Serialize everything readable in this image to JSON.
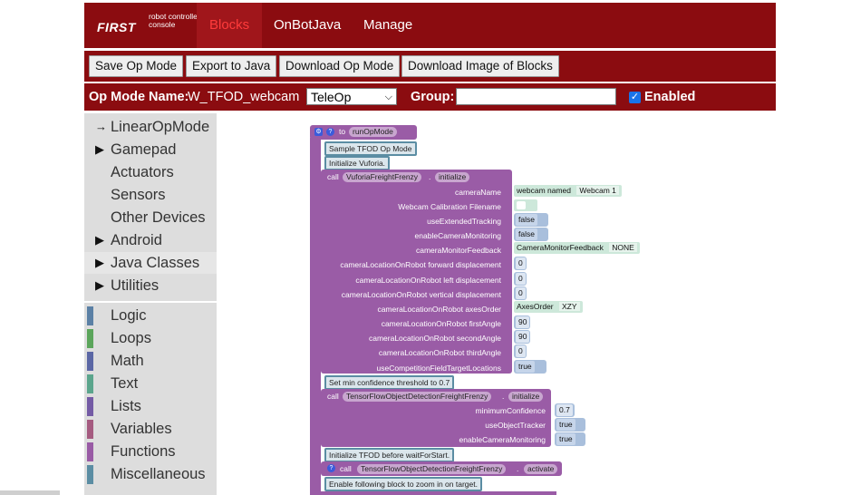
{
  "logo": {
    "first": "FIRST",
    "sub": "robot controller console"
  },
  "nav": {
    "tabs": [
      {
        "label": "Blocks",
        "active": true
      },
      {
        "label": "OnBotJava",
        "active": false
      },
      {
        "label": "Manage",
        "active": false
      }
    ]
  },
  "toolbar": {
    "save": "Save Op Mode",
    "export": "Export to Java",
    "download": "Download Op Mode",
    "download_image": "Download Image of Blocks"
  },
  "opmode": {
    "label": "Op Mode Name:",
    "name": "W_TFOD_webcam",
    "type": "TeleOp",
    "group_label": "Group:",
    "group_value": "",
    "enabled_label": "Enabled",
    "enabled": true
  },
  "sidebar": {
    "categories": [
      {
        "label": "LinearOpMode",
        "arrow": "→"
      },
      {
        "label": "Gamepad",
        "arrow": "▶"
      },
      {
        "label": "Actuators",
        "arrow": ""
      },
      {
        "label": "Sensors",
        "arrow": ""
      },
      {
        "label": "Other Devices",
        "arrow": ""
      },
      {
        "label": "Android",
        "arrow": "▶"
      },
      {
        "label": "Java Classes",
        "arrow": "▶"
      },
      {
        "label": "Utilities",
        "arrow": "▶"
      }
    ],
    "builtins": [
      {
        "label": "Logic",
        "color": "#5b80a5"
      },
      {
        "label": "Loops",
        "color": "#5ba55b"
      },
      {
        "label": "Math",
        "color": "#5b67a5"
      },
      {
        "label": "Text",
        "color": "#5ba58c"
      },
      {
        "label": "Lists",
        "color": "#745ba5"
      },
      {
        "label": "Variables",
        "color": "#a55b80"
      },
      {
        "label": "Functions",
        "color": "#995ba5"
      },
      {
        "label": "Miscellaneous",
        "color": "#5b8da3"
      }
    ]
  },
  "blocks": {
    "to": "to",
    "func_name": "runOpMode",
    "comment1": "Sample TFOD Op Mode",
    "comment2": "Initialize Vuforia.",
    "call": "call",
    "vuforia_class": "VuforiaFreightFrenzy",
    "dot": ".",
    "init": "initialize",
    "params": [
      {
        "label": "cameraName",
        "value": "webcam named",
        "value2": "Webcam 1"
      },
      {
        "label": "Webcam Calibration Filename",
        "value": "",
        "value2": ""
      },
      {
        "label": "useExtendedTracking",
        "value": "false",
        "value2": ""
      },
      {
        "label": "enableCameraMonitoring",
        "value": "false",
        "value2": ""
      },
      {
        "label": "cameraMonitorFeedback",
        "value": "CameraMonitorFeedback",
        "value2": "NONE"
      },
      {
        "label": "cameraLocationOnRobot forward displacement",
        "value": "0",
        "value2": ""
      },
      {
        "label": "cameraLocationOnRobot left displacement",
        "value": "0",
        "value2": ""
      },
      {
        "label": "cameraLocationOnRobot vertical displacement",
        "value": "0",
        "value2": ""
      },
      {
        "label": "cameraLocationOnRobot axesOrder",
        "value": "AxesOrder",
        "value2": "XZY"
      },
      {
        "label": "cameraLocationOnRobot firstAngle",
        "value": "90",
        "value2": ""
      },
      {
        "label": "cameraLocationOnRobot secondAngle",
        "value": "90",
        "value2": ""
      },
      {
        "label": "cameraLocationOnRobot thirdAngle",
        "value": "0",
        "value2": ""
      },
      {
        "label": "useCompetitionFieldTargetLocations",
        "value": "true",
        "value2": ""
      }
    ],
    "comment3": "Set min confidence threshold to 0.7",
    "tfod_class": "TensorFlowObjectDetectionFreightFrenzy",
    "tfod_params": [
      {
        "label": "minimumConfidence",
        "value": "0.7"
      },
      {
        "label": "useObjectTracker",
        "value": "true"
      },
      {
        "label": "enableCameraMonitoring",
        "value": "true"
      }
    ],
    "comment4": "Initialize TFOD before waitForStart.",
    "activate": "activate",
    "comment5": "Enable following block to zoom in on target."
  }
}
